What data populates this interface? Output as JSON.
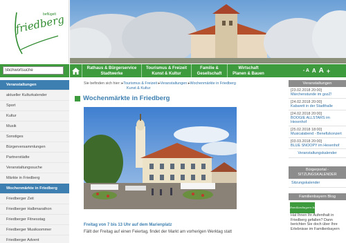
{
  "logo": {
    "word": "friedberg",
    "sub": "beflügelt"
  },
  "search": {
    "value": "Stichwortsuche"
  },
  "nav": {
    "items": [
      {
        "line1": "Rathaus & Bürgerservice",
        "line2": "Stadtwerke"
      },
      {
        "line1": "Tourismus & Freizeit",
        "line2": "Kunst & Kultur"
      },
      {
        "line1": "Familie &",
        "line2": "Gesellschaft"
      },
      {
        "line1": "Wirtschaft",
        "line2": "Planen & Bauen"
      }
    ]
  },
  "font_size": {
    "small": "- A",
    "medium": "A",
    "large": "A",
    "plus": "+"
  },
  "left_nav": {
    "items": [
      {
        "label": "Veranstaltungen",
        "type": "head"
      },
      {
        "label": "aktueller Kulturkalender",
        "type": "sub"
      },
      {
        "label": "Sport",
        "type": "sub"
      },
      {
        "label": "Kultur",
        "type": "sub"
      },
      {
        "label": "Musik",
        "type": "sub"
      },
      {
        "label": "Sonstiges",
        "type": "sub"
      },
      {
        "label": "Bürgerversammlungen",
        "type": "sub"
      },
      {
        "label": "Partnerstädte",
        "type": "sub"
      },
      {
        "label": "Veranstaltungssuche",
        "type": "sub"
      },
      {
        "label": "Märkte in Friedberg",
        "type": "sub"
      },
      {
        "label": "Wochenmärkte in Friedberg",
        "type": "active"
      },
      {
        "label": "Friedberger Zeit",
        "type": "sub"
      },
      {
        "label": "Friedberger Halbmarathon",
        "type": "sub"
      },
      {
        "label": "Friedberger Fitnesstag",
        "type": "sub"
      },
      {
        "label": "Friedberger Musiksommer",
        "type": "sub"
      },
      {
        "label": "Friedberger Advent",
        "type": "sub"
      }
    ]
  },
  "breadcrumb": {
    "prefix": "Sie befinden sich hier:",
    "items": [
      "Tourismus & Freizeit",
      "Veranstaltungen",
      "Wochenmärkte in Friedberg",
      "Kunst & Kultur"
    ]
  },
  "main": {
    "title": "Wochenmärkte in Friedberg",
    "lead": "Freitag von 7 bis 13 Uhr auf dem Marienplatz",
    "body": "Fällt der Freitag auf einen Feiertag, findet der Markt am vorherigen Werktag statt"
  },
  "right": {
    "events_head": "Veranstaltungen",
    "events": [
      {
        "date": "[23.02.2018 20:00]",
        "title": "Märchenstunde im gozZ!"
      },
      {
        "date": "[24.02.2018 20:00]",
        "title": "Kabarett in der Stadthalle"
      },
      {
        "date": "[24.02.2018 20:00]",
        "title": "BOOGIE ALLSTARS im Hexenhof"
      },
      {
        "date": "[25.02.2018 18:00]",
        "title": "Musicalabend - Benefizkonzert"
      },
      {
        "date": "[03.03.2018 20:00]",
        "title": "BLUE SNOOPY im Hexenhof"
      }
    ],
    "events_more": "Veranstaltungskalender",
    "portal_head_1": "Bürgerportal -",
    "portal_head_2": "SITZUNGSKALENDER",
    "portal_link": "Sitzungskalender",
    "blog_head": "Familienbayern Blog",
    "blog_badge": "Familienbayern.blog",
    "blog_text": [
      "Hat Ihnen Ihr Aufenthalt in",
      "Friedberg gefallen? Dann",
      "berichten Sie doch über Ihre",
      "Erlebnisse im Familienbayern"
    ]
  },
  "colors": {
    "green": "#3d9a3d",
    "blue": "#3d7fb0",
    "link": "#2a6fa8",
    "grey_head": "#8c8c8c"
  }
}
